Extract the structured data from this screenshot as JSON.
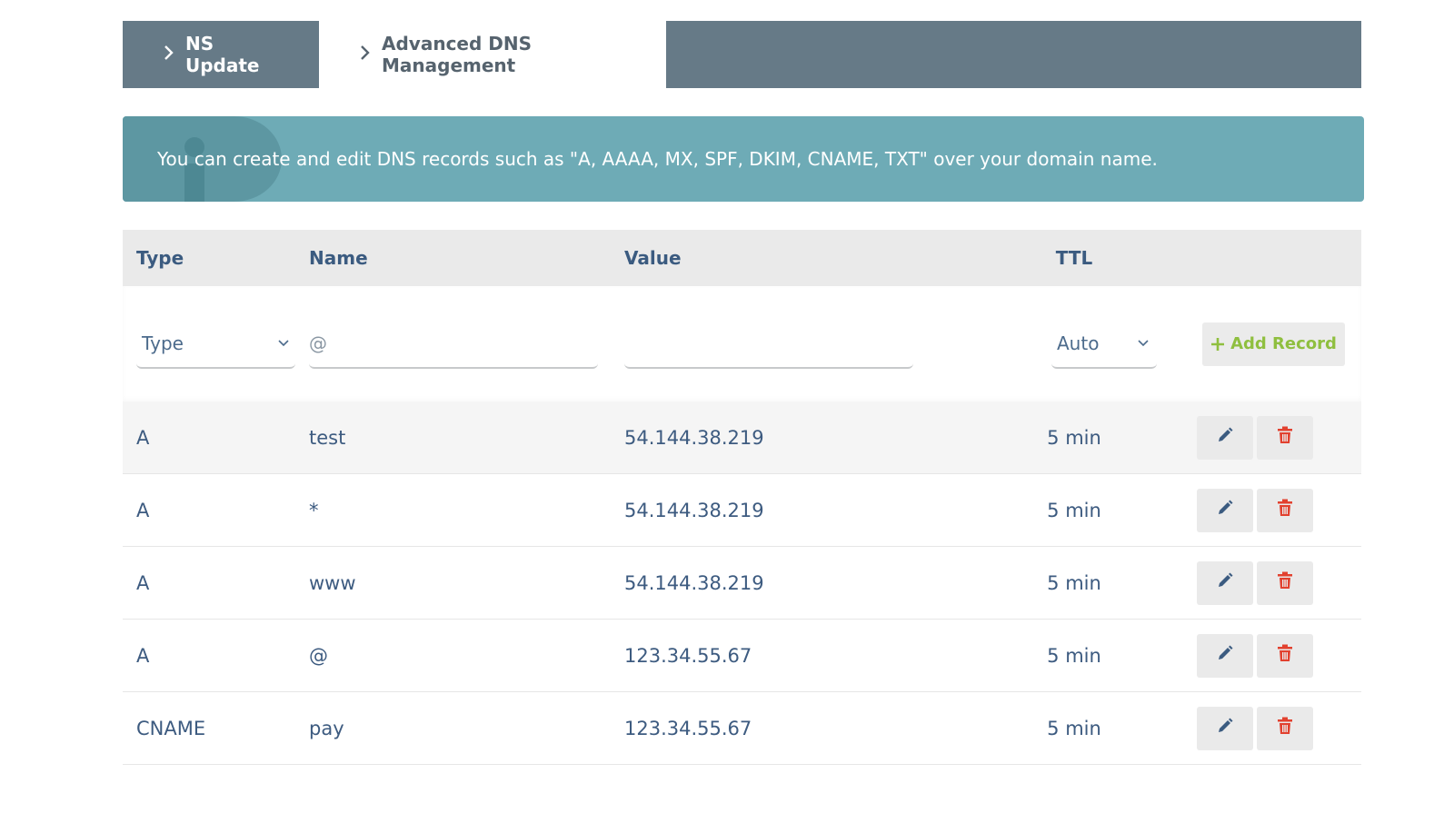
{
  "tabs": [
    {
      "label": "NS Update",
      "active": false
    },
    {
      "label": "Advanced DNS Management",
      "active": true
    }
  ],
  "info": {
    "text": "You can create and edit DNS records such as \"A, AAAA, MX, SPF, DKIM, CNAME, TXT\" over your domain name.",
    "icon": "info-icon"
  },
  "table": {
    "headers": {
      "type": "Type",
      "name": "Name",
      "value": "Value",
      "ttl": "TTL"
    },
    "form": {
      "type_select_value": "Type",
      "name_placeholder": "@",
      "value_placeholder": "",
      "ttl_select_value": "Auto",
      "add_button_label": "Add Record"
    },
    "rows": [
      {
        "type": "A",
        "name": "test",
        "value": "54.144.38.219",
        "ttl": "5 min"
      },
      {
        "type": "A",
        "name": "*",
        "value": "54.144.38.219",
        "ttl": "5 min"
      },
      {
        "type": "A",
        "name": "www",
        "value": "54.144.38.219",
        "ttl": "5 min"
      },
      {
        "type": "A",
        "name": "@",
        "value": "123.34.55.67",
        "ttl": "5 min"
      },
      {
        "type": "CNAME",
        "name": "pay",
        "value": "123.34.55.67",
        "ttl": "5 min"
      }
    ]
  },
  "colors": {
    "tab_bar": "#667a87",
    "info_bg": "#6eabb6",
    "header_text": "#3b5b80",
    "add_green": "#8fbf3f",
    "delete_red": "#e2412f",
    "edit_blue": "#3b5b80"
  },
  "icons": {
    "tab_chevron": "chevron-right-icon",
    "select_caret": "chevron-down-icon",
    "add": "plus-icon",
    "edit": "pencil-icon",
    "delete": "trash-icon"
  }
}
